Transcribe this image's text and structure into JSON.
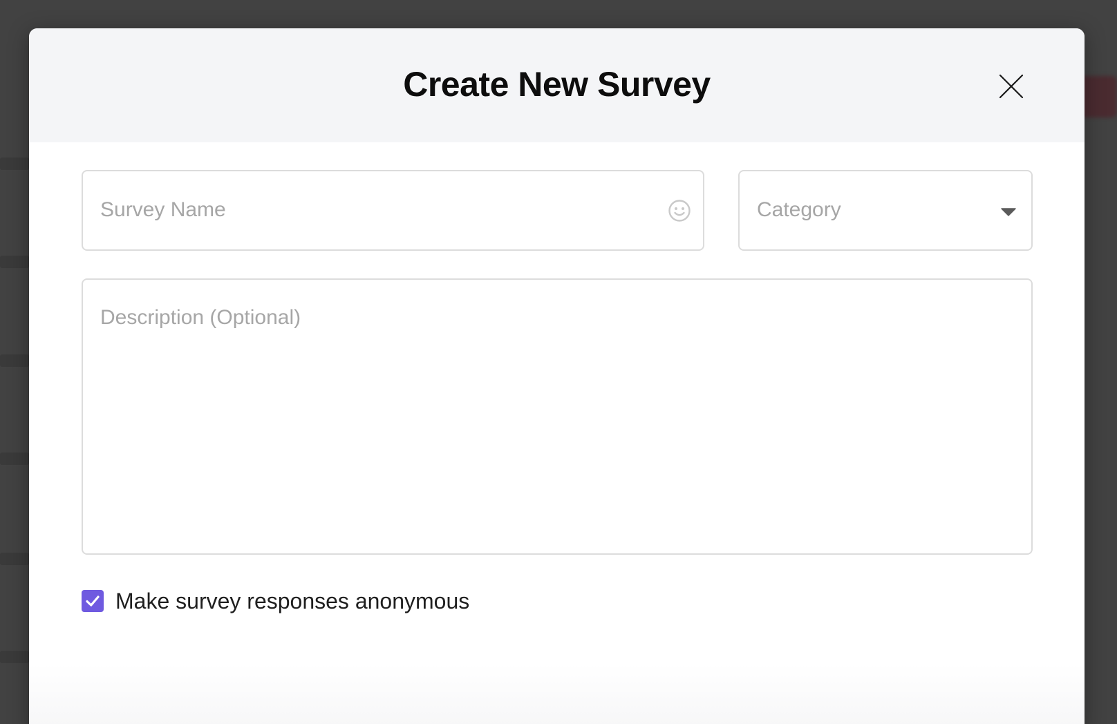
{
  "modal": {
    "title": "Create New Survey"
  },
  "form": {
    "survey_name_placeholder": "Survey Name",
    "category_placeholder": "Category",
    "description_placeholder": "Description (Optional)",
    "anonymous_label": "Make survey responses anonymous",
    "anonymous_checked": true
  },
  "icons": {
    "close": "close-icon",
    "emoji": "emoji-icon",
    "dropdown": "chevron-down-icon",
    "check": "checkmark-icon"
  },
  "colors": {
    "accent": "#6f5ae0",
    "overlay": "#424242",
    "header_bg": "#f4f5f7",
    "placeholder": "#a6a6a6",
    "border": "#dcdcdc"
  }
}
